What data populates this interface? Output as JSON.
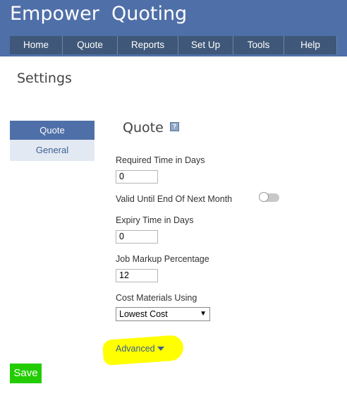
{
  "app": {
    "title": "Empower  Quoting"
  },
  "nav": {
    "items": [
      "Home",
      "Quote",
      "Reports",
      "Set Up",
      "Tools",
      "Help"
    ]
  },
  "page": {
    "title": "Settings"
  },
  "side_nav": {
    "items": [
      {
        "label": "Quote",
        "active": true
      },
      {
        "label": "General",
        "active": false
      }
    ]
  },
  "section": {
    "title": "Quote",
    "help_icon": "help-icon"
  },
  "fields": {
    "required_time": {
      "label": "Required Time in Days",
      "value": "0"
    },
    "valid_until": {
      "label": "Valid Until End Of Next Month",
      "on": false
    },
    "expiry_time": {
      "label": "Expiry Time in Days",
      "value": "0"
    },
    "job_markup": {
      "label": "Job Markup Percentage",
      "value": "12"
    },
    "cost_materials": {
      "label": "Cost Materials Using",
      "value": "Lowest Cost"
    }
  },
  "advanced": {
    "label": "Advanced"
  },
  "save": {
    "label": "Save"
  },
  "colors": {
    "header": "#4f6fa8",
    "nav": "#3f5778",
    "save": "#22cc00",
    "highlight": "#ffff00"
  }
}
